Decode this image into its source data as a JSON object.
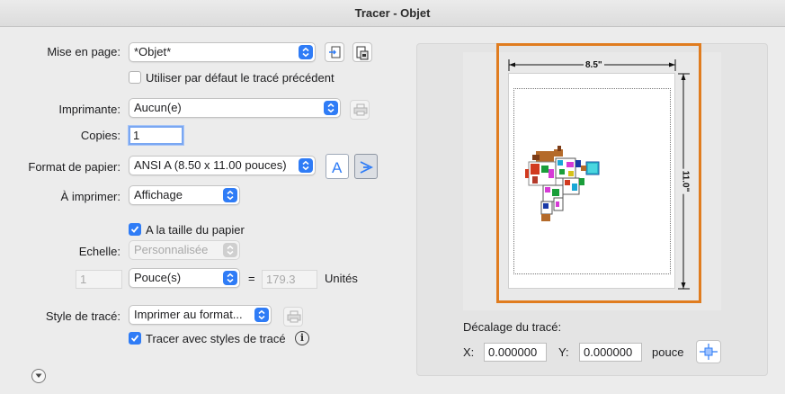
{
  "window": {
    "title": "Tracer - Objet"
  },
  "page_setup": {
    "label": "Mise en page:",
    "value": "*Objet*",
    "use_previous_label": "Utiliser par défaut le tracé précédent",
    "use_previous_checked": false
  },
  "printer": {
    "label": "Imprimante:",
    "value": "Aucun(e)"
  },
  "copies": {
    "label": "Copies:",
    "value": "1"
  },
  "paper_size": {
    "label": "Format de papier:",
    "value": "ANSI A (8.50 x 11.00 pouces)"
  },
  "what_to_plot": {
    "label": "À imprimer:",
    "value": "Affichage"
  },
  "fit_to_paper": {
    "label": "A la taille du papier",
    "checked": true
  },
  "scale": {
    "label": "Echelle:",
    "value": "Personnalisée",
    "numerator": "1",
    "unit": "Pouce(s)",
    "equals": "=",
    "denominator": "179.3",
    "units_label": "Unités"
  },
  "plot_style": {
    "label": "Style de tracé:",
    "value": "Imprimer au format...",
    "with_styles_label": "Tracer avec styles de tracé",
    "with_styles_checked": true,
    "info_icon_text": "i"
  },
  "preview": {
    "width_label": "8.5\"",
    "height_label": "11.0\""
  },
  "offset": {
    "label": "Décalage du tracé:",
    "x_label": "X:",
    "x_value": "0.000000",
    "y_label": "Y:",
    "y_value": "0.000000",
    "unit": "pouce"
  },
  "colors": {
    "accent": "#2f7cf6",
    "highlight": "#e07c1f"
  }
}
